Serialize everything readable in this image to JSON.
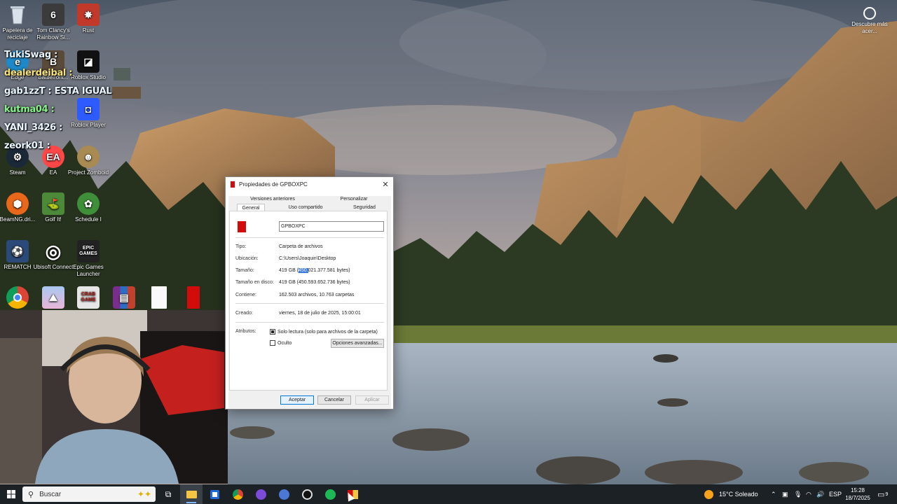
{
  "desktop": {
    "icons": [
      {
        "label": "Papelera de reciclaje",
        "icon": "recycle-bin-icon"
      },
      {
        "label": "Tom Clancy's Rainbow Si...",
        "icon": "rainbow-six-icon"
      },
      {
        "label": "Rust",
        "icon": "rust-icon"
      },
      {
        "label": "Edge",
        "icon": "edge-icon"
      },
      {
        "label": "Battlefront...",
        "icon": "battlefront-icon"
      },
      {
        "label": "Roblox Studio",
        "icon": "roblox-studio-icon"
      },
      {
        "label": "Roblox Player",
        "icon": "roblox-player-icon"
      },
      {
        "label": "Steam",
        "icon": "steam-icon"
      },
      {
        "label": "EA",
        "icon": "ea-icon"
      },
      {
        "label": "Project Zomboid",
        "icon": "project-zomboid-icon"
      },
      {
        "label": "BeamNG.dri...",
        "icon": "beamng-icon"
      },
      {
        "label": "Golf It!",
        "icon": "golf-it-icon"
      },
      {
        "label": "Schedule I",
        "icon": "schedule-one-icon"
      },
      {
        "label": "REMATCH",
        "icon": "rematch-icon"
      },
      {
        "label": "Ubisoft Connect",
        "icon": "ubisoft-icon"
      },
      {
        "label": "Epic Games Launcher",
        "icon": "epic-games-icon"
      },
      {
        "label": "",
        "icon": "chrome-icon"
      },
      {
        "label": "",
        "icon": "app-icon"
      },
      {
        "label": "",
        "icon": "crab-game-icon"
      },
      {
        "label": "",
        "icon": "winrar-icon"
      },
      {
        "label": "",
        "icon": "blank-file-icon"
      },
      {
        "label": "",
        "icon": "red-folder-icon"
      }
    ],
    "epic_text": "EPIC GAMES",
    "crab_text": "CRAB GAME",
    "discover": {
      "label": "Descubre más acer..."
    }
  },
  "chat": [
    {
      "text": "TukiSwag :",
      "color": "#e9f6ff"
    },
    {
      "text": "dealerdeibal :",
      "color": "#f7e27a"
    },
    {
      "text": "gab1zzT : ESTA IGUAL",
      "color": "#e9f6ff"
    },
    {
      "text": "kutma04 :",
      "color": "#88f58a"
    },
    {
      "text": "YANI_3426 :",
      "color": "#e9f6ff"
    },
    {
      "text": "zeork01 :",
      "color": "#e9f6ff"
    }
  ],
  "dialog": {
    "title": "Propiedades de GPBOXPC",
    "close_label": "✕",
    "tabs": {
      "versiones": "Versiones anteriores",
      "personalizar": "Personalizar",
      "general": "General",
      "uso": "Uso compartido",
      "seguridad": "Seguridad"
    },
    "name_value": "GPBOXPC",
    "rows": {
      "tipo_label": "Tipo:",
      "tipo_value": "Carpeta de archivos",
      "ubicacion_label": "Ubicación:",
      "ubicacion_value": "C:\\Users\\Joaquin\\Desktop",
      "tamano_label": "Tamaño:",
      "tamano_prefix": "419 GB (",
      "tamano_selected": "450.",
      "tamano_suffix": "021.377.581 bytes)",
      "disco_label": "Tamaño en disco:",
      "disco_value": "419 GB (450.593.652.736 bytes)",
      "contiene_label": "Contiene:",
      "contiene_value": "162.503 archivos, 10.763 carpetas",
      "creado_label": "Creado:",
      "creado_value": "viernes, 18 de julio de 2025, 15:00:01",
      "atributos_label": "Atributos:"
    },
    "readonly_label": "Solo lectura (solo para archivos de la carpeta)",
    "readonly_checked": true,
    "oculto_label": "Oculto",
    "oculto_checked": false,
    "advanced_button": "Opciones avanzadas...",
    "buttons": {
      "ok": "Aceptar",
      "cancel": "Cancelar",
      "apply": "Aplicar"
    }
  },
  "taskbar": {
    "search_placeholder": "Buscar",
    "apps": [
      "start-icon",
      "search-icon",
      "task-view-icon",
      "file-explorer-icon",
      "microsoft-store-icon",
      "chrome-icon",
      "discord-icon",
      "app-icon",
      "obs-icon",
      "spotify-icon",
      "folder-properties-icon"
    ],
    "weather": "15°C Soleado",
    "language": "ESP",
    "time": "15:28",
    "date": "18/7/2025",
    "notification_count": "9"
  }
}
